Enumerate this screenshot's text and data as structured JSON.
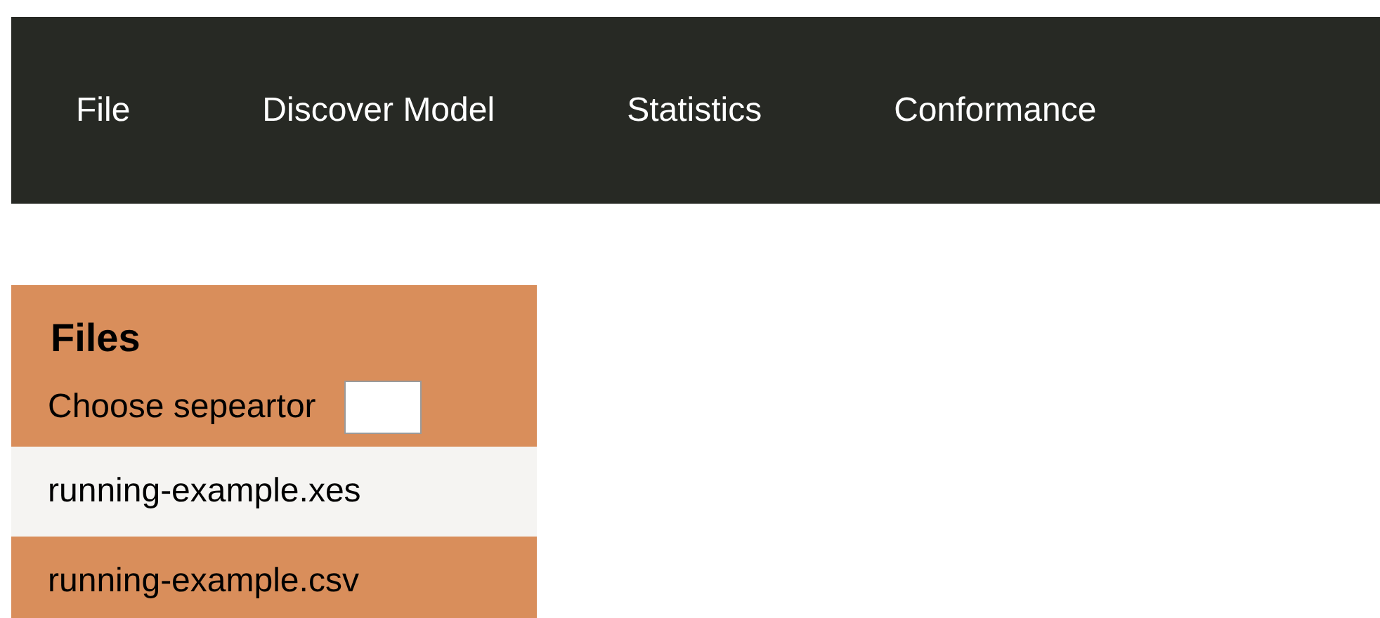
{
  "menu": [
    {
      "label": "File"
    },
    {
      "label": "Discover Model"
    },
    {
      "label": "Statistics"
    },
    {
      "label": "Conformance"
    }
  ],
  "files_panel": {
    "title": "Files",
    "separator_label": "Choose sepeartor",
    "files": [
      {
        "name": "running-example.xes",
        "selected": false
      },
      {
        "name": "running-example.csv",
        "selected": true
      }
    ]
  }
}
